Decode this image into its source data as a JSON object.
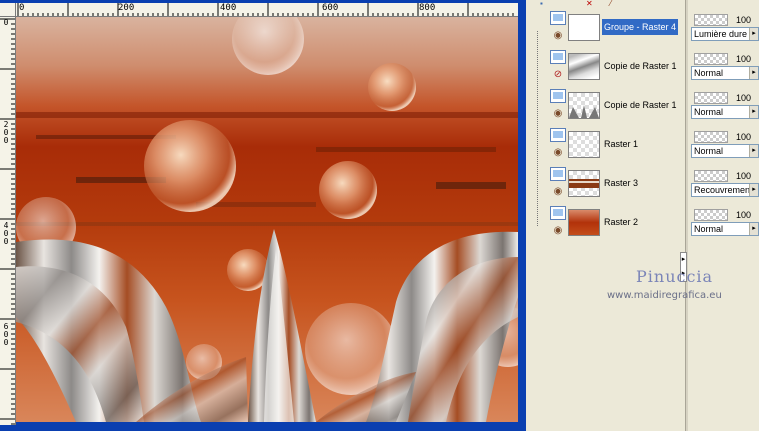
{
  "canvas": {
    "ruler_top_labels": [
      "0",
      "200",
      "400",
      "600",
      "800"
    ],
    "ruler_left_labels": [
      "0",
      "2 0 0",
      "4 0 0",
      "6 0 0"
    ]
  },
  "layers": [
    {
      "name": "Groupe - Raster 4",
      "selected": true,
      "visible": true,
      "thumb": "group"
    },
    {
      "name": "Copie de Raster 1",
      "selected": false,
      "visible": false,
      "thumb": "grey-wave"
    },
    {
      "name": "Copie de Raster 1",
      "selected": false,
      "visible": true,
      "thumb": "bottom-waves"
    },
    {
      "name": "Raster 1",
      "selected": false,
      "visible": true,
      "thumb": "empty"
    },
    {
      "name": "Raster 3",
      "selected": false,
      "visible": true,
      "thumb": "brown-band"
    },
    {
      "name": "Raster 2",
      "selected": false,
      "visible": true,
      "thumb": "red-gradient"
    }
  ],
  "properties": [
    {
      "opacity": "100",
      "blend": "Lumière dure"
    },
    {
      "opacity": "100",
      "blend": "Normal"
    },
    {
      "opacity": "100",
      "blend": "Normal"
    },
    {
      "opacity": "100",
      "blend": "Normal"
    },
    {
      "opacity": "100",
      "blend": "Recouvrement"
    },
    {
      "opacity": "100",
      "blend": "Normal"
    }
  ],
  "icons": {
    "eye": "eye-icon",
    "eye_hidden": "eye-hidden-icon",
    "layer_doc": "raster-layer-icon",
    "dropdown": "chevron-right-icon",
    "delete": "close-icon"
  },
  "watermark": {
    "name": "Pinuccia",
    "url": "www.maidiregrafica.eu"
  },
  "colors": {
    "selection": "#316ac5",
    "window_frame": "#0a3fb0",
    "panel_bg": "#ece9d8"
  }
}
